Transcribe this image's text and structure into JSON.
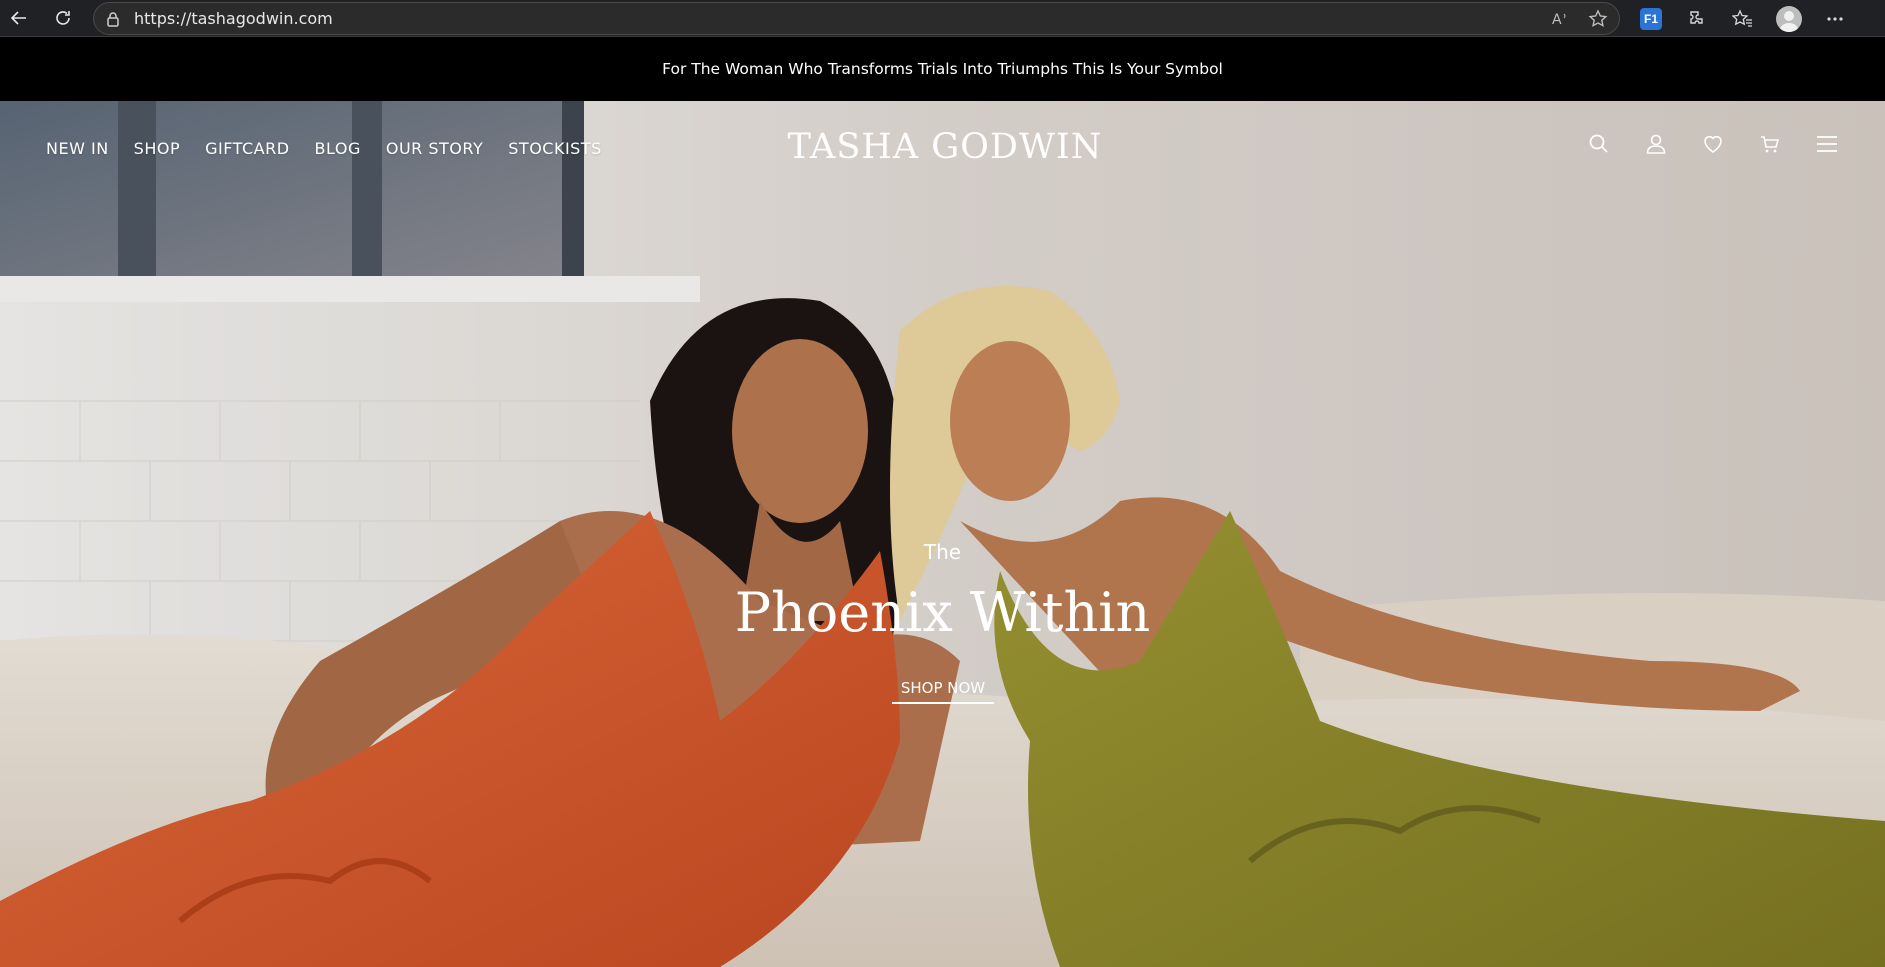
{
  "browser": {
    "url": "https://tashagodwin.com",
    "extension_badge": "F1"
  },
  "announcement": {
    "text": "For The Woman Who Transforms Trials Into Triumphs This Is Your Symbol"
  },
  "header": {
    "logo": "TASHA GODWIN",
    "nav": [
      "NEW IN",
      "SHOP",
      "GIFTCARD",
      "BLOG",
      "OUR STORY",
      "STOCKISTS"
    ],
    "icons": [
      "search-icon",
      "account-icon",
      "wishlist-icon",
      "cart-icon",
      "menu-icon"
    ]
  },
  "hero": {
    "kicker": "The",
    "title": "Phoenix Within",
    "cta": "SHOP NOW"
  },
  "colors": {
    "announcement_bg": "#000000",
    "orange_dress": "#d8582d",
    "olive_dress": "#8d8a2c",
    "wall": "#e9e6e2",
    "sofa": "#e6dccf"
  }
}
